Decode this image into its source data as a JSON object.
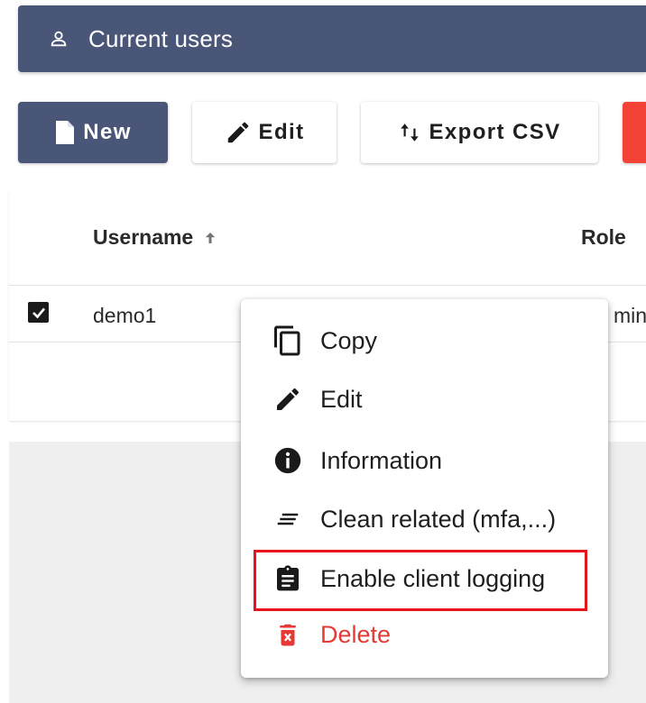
{
  "header": {
    "title": "Current users",
    "icon": "user-icon"
  },
  "toolbar": {
    "new_label": "New",
    "edit_label": "Edit",
    "export_label": "Export CSV",
    "delete_color": "#f44336"
  },
  "table": {
    "columns": [
      "Username",
      "Role"
    ],
    "sort_column": "Username",
    "sort_direction": "ascending",
    "rows": [
      {
        "username": "demo1",
        "role": "min",
        "checked": true
      }
    ]
  },
  "context_menu": {
    "items": [
      {
        "label": "Copy",
        "icon": "copy-icon"
      },
      {
        "label": "Edit",
        "icon": "pencil-icon"
      },
      {
        "label": "Information",
        "icon": "info-icon"
      },
      {
        "label": "Clean related (mfa,...)",
        "icon": "clean-icon"
      },
      {
        "label": "Enable client logging",
        "icon": "clipboard-icon",
        "highlighted": true
      },
      {
        "label": "Delete",
        "icon": "trash-icon",
        "danger": true
      }
    ]
  },
  "colors": {
    "primary": "#4a5677",
    "danger": "#e53935",
    "highlight": "#e8121a"
  }
}
